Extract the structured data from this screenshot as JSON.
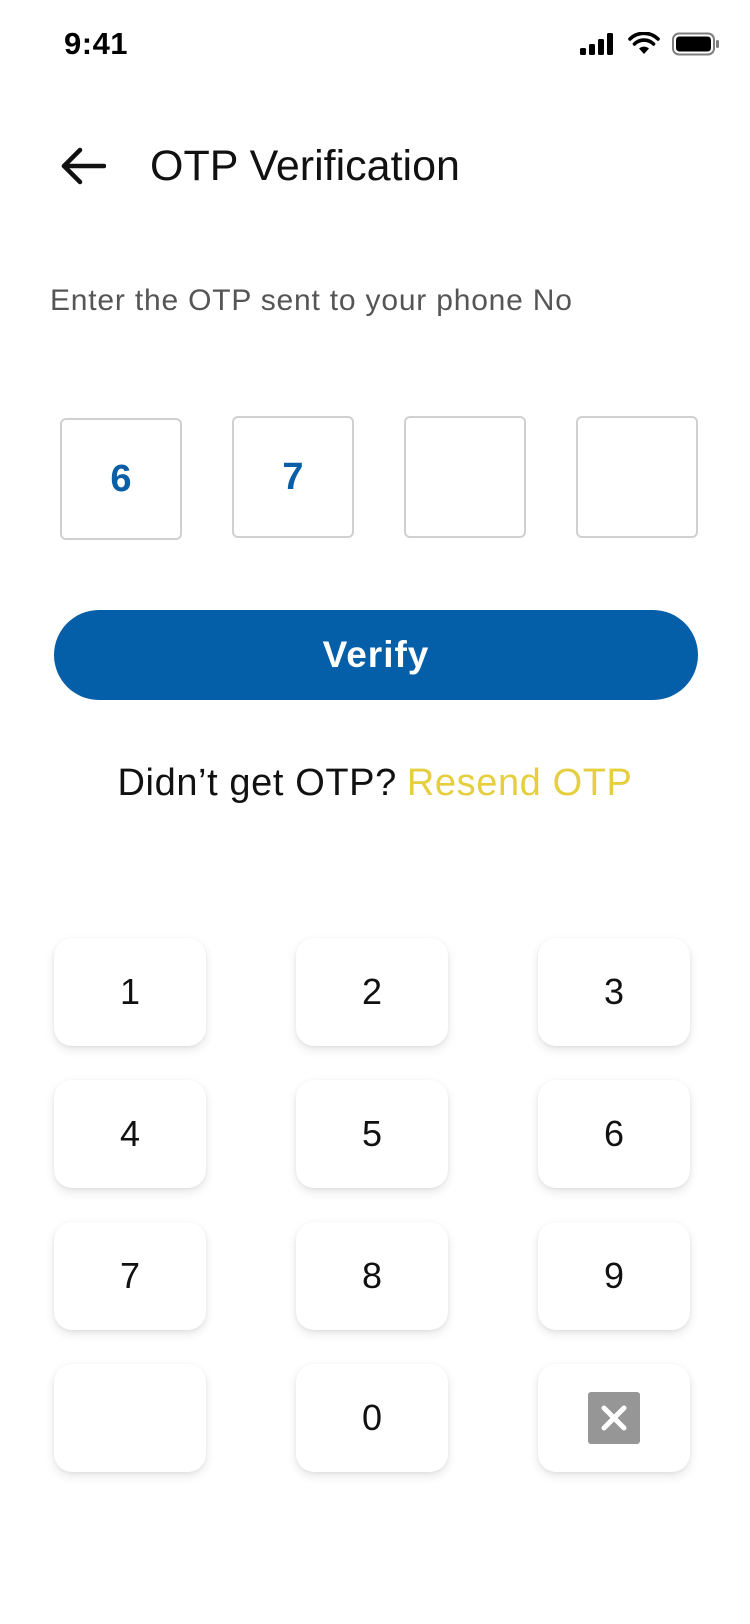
{
  "status_bar": {
    "time": "9:41",
    "icons": [
      "cellular-signal-icon",
      "wifi-icon",
      "battery-icon"
    ]
  },
  "header": {
    "back_icon": "arrow-left-icon",
    "title": "OTP Verification"
  },
  "instruction": "Enter the OTP sent to your phone No",
  "otp": {
    "digits": [
      "6",
      "7",
      "",
      ""
    ]
  },
  "verify_label": "Verify",
  "resend": {
    "prefix": "Didn’t get OTP?",
    "link": "Resend OTP"
  },
  "keypad": {
    "keys": [
      "1",
      "2",
      "3",
      "4",
      "5",
      "6",
      "7",
      "8",
      "9",
      "",
      "0"
    ],
    "delete_icon": "backspace-x-icon"
  },
  "colors": {
    "primary": "#055ea8",
    "accent": "#e5cf3e",
    "otp_digit": "#0a5ea8",
    "box_border": "#d0d0d0",
    "delete_key": "#969696"
  }
}
